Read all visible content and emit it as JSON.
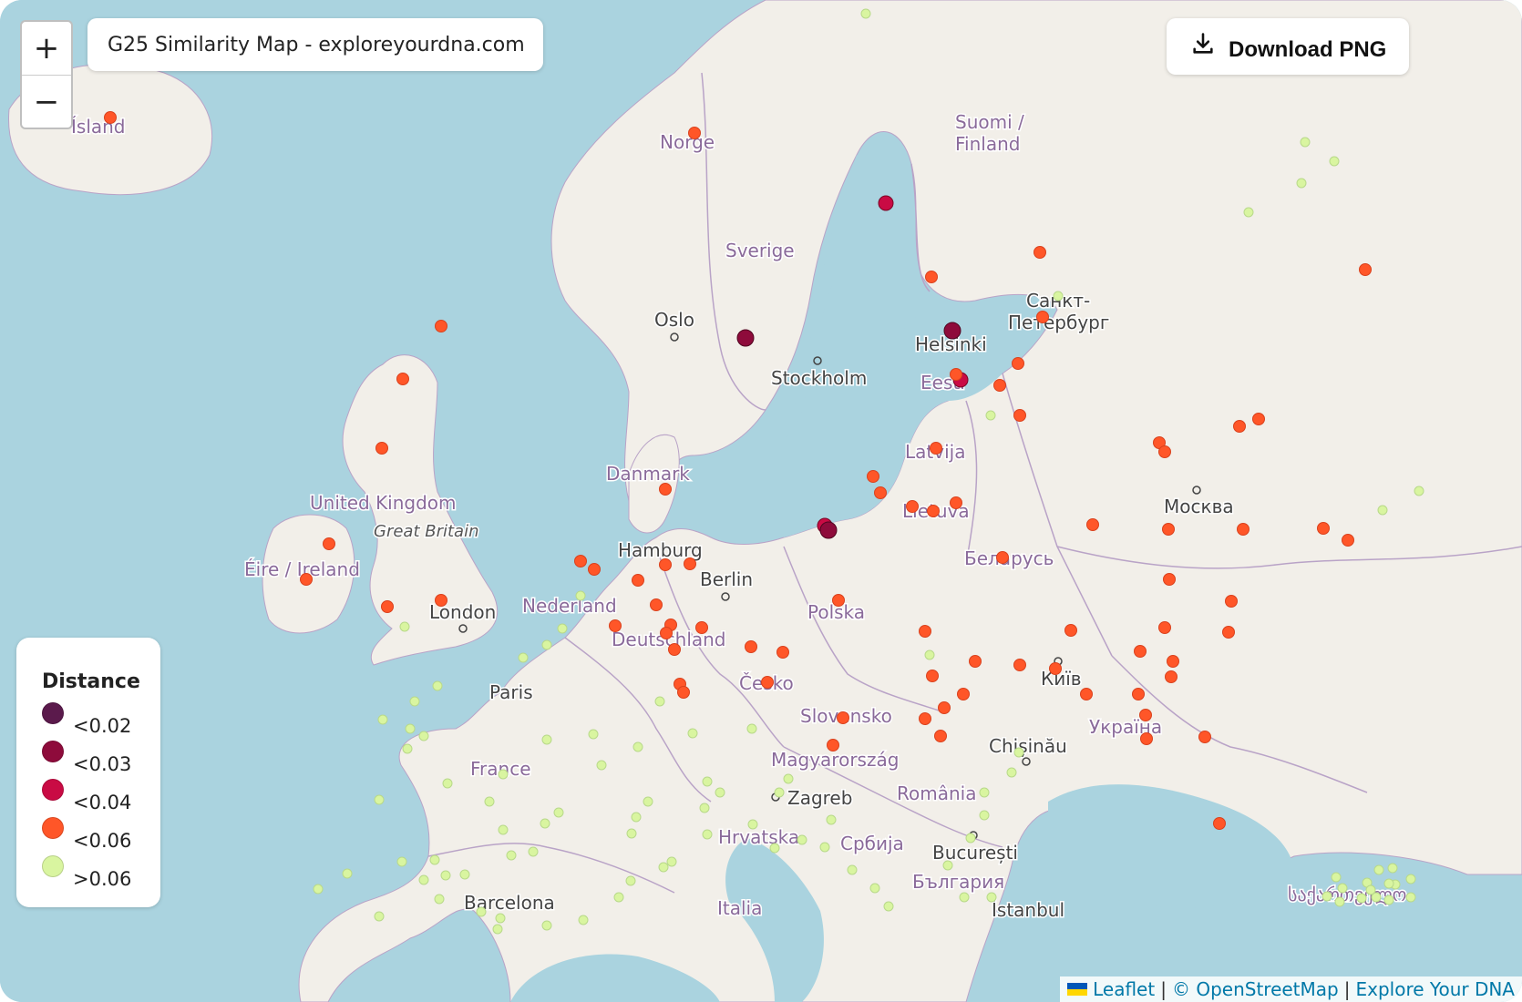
{
  "map": {
    "title": "G25 Similarity Map - exploreyourdna.com",
    "zoom_in": "+",
    "zoom_out": "−",
    "download_label": "Download PNG",
    "attribution": {
      "leaflet": "Leaflet",
      "osm": "© OpenStreetMap",
      "explore": "Explore Your DNA"
    }
  },
  "legend": {
    "title": "Distance",
    "items": [
      {
        "label": "<0.02",
        "color": "#5b1a4c"
      },
      {
        "label": "<0.03",
        "color": "#8e0b3b"
      },
      {
        "label": "<0.04",
        "color": "#c90b44"
      },
      {
        "label": "<0.06",
        "color": "#ff5628"
      },
      {
        "label": ">0.06",
        "color": "#d9f5a0"
      }
    ]
  },
  "place_labels": [
    "Ísland",
    "Norge",
    "Suomi /",
    "Finland",
    "Sverige",
    "Oslo",
    "Helsinki",
    "Санкт-",
    "Петербург",
    "Stockholm",
    "Eesti",
    "Latvija",
    "Danmark",
    "United Kingdom",
    "Great Britain",
    "Éire / Ireland",
    "Lietuva",
    "Москва",
    "Hamburg",
    "Berlin",
    "Беларусь",
    "Nederland",
    "London",
    "Polska",
    "Deutschland",
    "Київ",
    "Česko",
    "Paris",
    "Slovensko",
    "Україна",
    "Magyarország",
    "Chișinău",
    "France",
    "Zagreb",
    "România",
    "Hrvatska",
    "Србија",
    "București",
    "България",
    "Barcelona",
    "Italia",
    "İstanbul",
    "საქართველო"
  ]
}
